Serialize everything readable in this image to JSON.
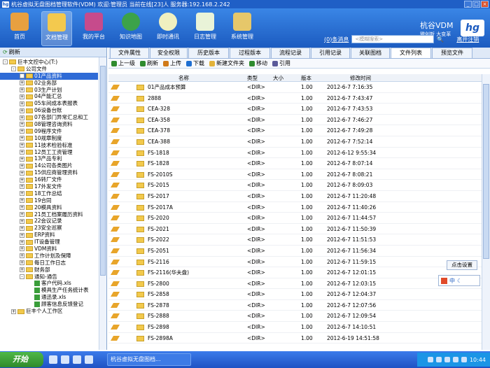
{
  "window": {
    "app_icon": "hg",
    "title": "杭谷虚拟无盘图档管理软件(VDM)  欢迎:管理员 当前在线[23]人 服务器:192.168.2.242",
    "min_label": "_",
    "max_label": "□",
    "close_label": "×"
  },
  "toolbar": {
    "items": [
      {
        "label": "首页",
        "icon": "home-icon",
        "active": false
      },
      {
        "label": "文档管理",
        "icon": "document-management-icon",
        "active": true
      },
      {
        "label": "我的平台",
        "icon": "platform-icon",
        "active": false
      },
      {
        "label": "知识地图",
        "icon": "globe-icon",
        "active": false
      },
      {
        "label": "即时通讯",
        "icon": "chat-icon",
        "active": false
      },
      {
        "label": "日志管理",
        "icon": "log-icon",
        "active": false
      },
      {
        "label": "系统管理",
        "icon": "settings-icon",
        "active": false
      }
    ],
    "brand_name": "杭谷VDM",
    "brand_sub": "微创新 大变革",
    "logo_text": "hg",
    "messages": "(0)条消息",
    "search_placeholder": "<模糊搜索>",
    "logout": "离开注销"
  },
  "left": {
    "header": "刷新",
    "tree": [
      {
        "label": "巨丰文控中心(T:)",
        "indent": 0,
        "type": "drive",
        "exp": "-"
      },
      {
        "label": "公司文件",
        "indent": 1,
        "type": "folder",
        "exp": "-"
      },
      {
        "label": "01产品资料",
        "indent": 2,
        "type": "folder",
        "exp": "+",
        "selected": true
      },
      {
        "label": "02业务部",
        "indent": 2,
        "type": "folder",
        "exp": "+"
      },
      {
        "label": "03生产计划",
        "indent": 2,
        "type": "folder",
        "exp": "+"
      },
      {
        "label": "04产能汇总",
        "indent": 2,
        "type": "folder",
        "exp": "+"
      },
      {
        "label": "05车间成本表报表",
        "indent": 2,
        "type": "folder",
        "exp": "+"
      },
      {
        "label": "06设备台账",
        "indent": 2,
        "type": "folder",
        "exp": "+"
      },
      {
        "label": "07各部门异常汇总和工",
        "indent": 2,
        "type": "folder",
        "exp": "+"
      },
      {
        "label": "08管理咨询资料",
        "indent": 2,
        "type": "folder",
        "exp": "+"
      },
      {
        "label": "09程序文件",
        "indent": 2,
        "type": "folder",
        "exp": "+"
      },
      {
        "label": "10规章制度",
        "indent": 2,
        "type": "folder",
        "exp": "+"
      },
      {
        "label": "11技术检验标准",
        "indent": 2,
        "type": "folder",
        "exp": "+"
      },
      {
        "label": "12员工工资管理",
        "indent": 2,
        "type": "folder",
        "exp": "+"
      },
      {
        "label": "13产品专利",
        "indent": 2,
        "type": "folder",
        "exp": "+"
      },
      {
        "label": "14公司各类图片",
        "indent": 2,
        "type": "folder",
        "exp": "+"
      },
      {
        "label": "15供应商管理资料",
        "indent": 2,
        "type": "folder",
        "exp": "+"
      },
      {
        "label": "16转厂文件",
        "indent": 2,
        "type": "folder",
        "exp": "+"
      },
      {
        "label": "17外发文件",
        "indent": 2,
        "type": "folder",
        "exp": "+"
      },
      {
        "label": "18工作总结",
        "indent": 2,
        "type": "folder",
        "exp": "+"
      },
      {
        "label": "19合同",
        "indent": 2,
        "type": "folder",
        "exp": "+"
      },
      {
        "label": "20模具资料",
        "indent": 2,
        "type": "folder",
        "exp": "+"
      },
      {
        "label": "21员工档案履历资料",
        "indent": 2,
        "type": "folder",
        "exp": "+"
      },
      {
        "label": "22会议记录",
        "indent": 2,
        "type": "folder",
        "exp": "+"
      },
      {
        "label": "23安全巡察",
        "indent": 2,
        "type": "folder",
        "exp": "+"
      },
      {
        "label": "ERP资料",
        "indent": 2,
        "type": "folder",
        "exp": "+"
      },
      {
        "label": "IT设备管理",
        "indent": 2,
        "type": "folder",
        "exp": "+"
      },
      {
        "label": "VDM资料",
        "indent": 2,
        "type": "folder",
        "exp": "+"
      },
      {
        "label": "工作计划及保障",
        "indent": 2,
        "type": "folder",
        "exp": "+"
      },
      {
        "label": "每日工作日志",
        "indent": 2,
        "type": "folder",
        "exp": "+"
      },
      {
        "label": "财务部",
        "indent": 2,
        "type": "folder",
        "exp": "+"
      },
      {
        "label": "通知-通告",
        "indent": 2,
        "type": "folder",
        "exp": "-"
      },
      {
        "label": "客户代码.xls",
        "indent": 3,
        "type": "file",
        "exp": ""
      },
      {
        "label": "模具生产任务统计表",
        "indent": 3,
        "type": "file",
        "exp": ""
      },
      {
        "label": "通迅录.xls",
        "indent": 3,
        "type": "file",
        "exp": ""
      },
      {
        "label": "顾客信息反馈登记",
        "indent": 3,
        "type": "file",
        "exp": ""
      },
      {
        "label": "巨丰个人工作区",
        "indent": 1,
        "type": "folder",
        "exp": "+"
      }
    ]
  },
  "tabs": [
    "文件属性",
    "安全权限",
    "历史版本",
    "过程版本",
    "流程记录",
    "引用记录",
    "关联图档",
    "文件列表",
    "预览文件"
  ],
  "active_tab": 7,
  "actions": [
    {
      "label": "上一级",
      "icon": "up-arrow-icon"
    },
    {
      "label": "刷新",
      "icon": "refresh-icon"
    },
    {
      "label": "上传",
      "icon": "upload-icon"
    },
    {
      "label": "下载",
      "icon": "download-icon"
    },
    {
      "label": "新建文件夹",
      "icon": "new-folder-icon"
    },
    {
      "label": "移动",
      "icon": "move-icon"
    },
    {
      "label": "引用",
      "icon": "link-icon"
    }
  ],
  "table": {
    "headers": {
      "name": "名称",
      "type": "类型",
      "size": "大小",
      "version": "版本",
      "time": "修改时间"
    },
    "rows": [
      {
        "name": "01产品成本预算",
        "type": "<DIR>",
        "size": "",
        "version": "1.00",
        "time": "2012-6-7 7:16:35"
      },
      {
        "name": "2888",
        "type": "<DIR>",
        "size": "",
        "version": "1.00",
        "time": "2012-6-7 7:43:47"
      },
      {
        "name": "CEA-328",
        "type": "<DIR>",
        "size": "",
        "version": "1.00",
        "time": "2012-6-7 7:43:53"
      },
      {
        "name": "CEA-358",
        "type": "<DIR>",
        "size": "",
        "version": "1.00",
        "time": "2012-6-7 7:46:27"
      },
      {
        "name": "CEA-378",
        "type": "<DIR>",
        "size": "",
        "version": "1.00",
        "time": "2012-6-7 7:49:28"
      },
      {
        "name": "CEA-388",
        "type": "<DIR>",
        "size": "",
        "version": "1.00",
        "time": "2012-6-7 7:52:14"
      },
      {
        "name": "FS-1818",
        "type": "<DIR>",
        "size": "",
        "version": "1.00",
        "time": "2012-6-12 9:55:34"
      },
      {
        "name": "FS-1828",
        "type": "<DIR>",
        "size": "",
        "version": "1.00",
        "time": "2012-6-7 8:07:14"
      },
      {
        "name": "FS-2010S",
        "type": "<DIR>",
        "size": "",
        "version": "1.00",
        "time": "2012-6-7 8:08:21"
      },
      {
        "name": "FS-2015",
        "type": "<DIR>",
        "size": "",
        "version": "1.00",
        "time": "2012-6-7 8:09:03"
      },
      {
        "name": "FS-2017",
        "type": "<DIR>",
        "size": "",
        "version": "1.00",
        "time": "2012-6-7 11:20:48"
      },
      {
        "name": "FS-2017A",
        "type": "<DIR>",
        "size": "",
        "version": "1.00",
        "time": "2012-6-7 11:40:26"
      },
      {
        "name": "FS-2020",
        "type": "<DIR>",
        "size": "",
        "version": "1.00",
        "time": "2012-6-7 11:44:57"
      },
      {
        "name": "FS-2021",
        "type": "<DIR>",
        "size": "",
        "version": "1.00",
        "time": "2012-6-7 11:50:39"
      },
      {
        "name": "FS-2022",
        "type": "<DIR>",
        "size": "",
        "version": "1.00",
        "time": "2012-6-7 11:51:53"
      },
      {
        "name": "FS-2051",
        "type": "<DIR>",
        "size": "",
        "version": "1.00",
        "time": "2012-6-7 11:56:34"
      },
      {
        "name": "FS-2116",
        "type": "<DIR>",
        "size": "",
        "version": "1.00",
        "time": "2012-6-7 11:59:15"
      },
      {
        "name": "FS-2116(华夫盘)",
        "type": "<DIR>",
        "size": "",
        "version": "1.00",
        "time": "2012-6-7 12:01:15"
      },
      {
        "name": "FS-2800",
        "type": "<DIR>",
        "size": "",
        "version": "1.00",
        "time": "2012-6-7 12:03:15"
      },
      {
        "name": "FS-2858",
        "type": "<DIR>",
        "size": "",
        "version": "1.00",
        "time": "2012-6-7 12:04:37"
      },
      {
        "name": "FS-2878",
        "type": "<DIR>",
        "size": "",
        "version": "1.00",
        "time": "2012-6-7 12:07:56"
      },
      {
        "name": "FS-2888",
        "type": "<DIR>",
        "size": "",
        "version": "1.00",
        "time": "2012-6-7 12:09:54"
      },
      {
        "name": "FS-2898",
        "type": "<DIR>",
        "size": "",
        "version": "1.00",
        "time": "2012-6-7 14:10:51"
      },
      {
        "name": "FS-2898A",
        "type": "<DIR>",
        "size": "",
        "version": "1.00",
        "time": "2012-6-19 14:51:58"
      }
    ]
  },
  "ime": {
    "tooltip": "点击设置",
    "label": "中"
  },
  "taskbar": {
    "start_label": "开始",
    "app_label": "杭谷虚拟无盘图档...",
    "clock": "10:44"
  },
  "colors": {
    "toolbar": "#2a6fd6",
    "selection": "#2f6bd6",
    "taskbar": "#245edb",
    "start": "#3a9e34"
  }
}
